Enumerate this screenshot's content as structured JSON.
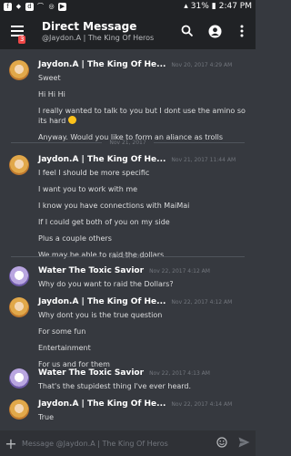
{
  "status_bar": {
    "left_icons": [
      "facebook-icon",
      "snapchat-icon",
      "discord-icon",
      "wifi-icon",
      "instagram-icon",
      "youtube-icon"
    ],
    "battery": "31%",
    "time": "2:47 PM"
  },
  "header": {
    "title": "Direct Message",
    "subtitle": "@Jaydon.A | The King Of Heros",
    "badge": "3"
  },
  "dividers": [
    "Nov 21, 2017",
    "Nov 22, 2017"
  ],
  "messages": [
    {
      "author": "Jaydon.A | The King Of He...",
      "time": "Nov 20, 2017 4:29 AM",
      "lines": [
        "Sweet",
        "Hi Hi Hi",
        "I really wanted to talk to you but I dont use the amino so its hard",
        "Anyway. Would you like to form an aliance as trolls"
      ]
    },
    {
      "author": "Jaydon.A | The King Of He...",
      "time": "Nov 21, 2017 11:44 AM",
      "lines": [
        "I feel I should be more specific",
        "I want you to work with me",
        "I know you have connections with MaiMai",
        "If I could get both of you on my side",
        "Plus a couple others",
        "We may be able to raid the dollars"
      ]
    },
    {
      "author": "Water The Toxic Savior",
      "time": "Nov 22, 2017 4:12 AM",
      "lines": [
        "Why do you want to raid the Dollars?"
      ]
    },
    {
      "author": "Jaydon.A | The King Of He...",
      "time": "Nov 22, 2017 4:12 AM",
      "lines": [
        "Why dont you is the true question",
        "For some fun",
        "Entertainment",
        "For us and for them"
      ]
    },
    {
      "author": "Water The Toxic Savior",
      "time": "Nov 22, 2017 4:13 AM",
      "lines": [
        "That's the stupidest thing I've ever heard."
      ]
    },
    {
      "author": "Jaydon.A | The King Of He...",
      "time": "Nov 22, 2017 4:14 AM",
      "lines": [
        "True"
      ]
    }
  ],
  "composer": {
    "placeholder": "Message @Jaydon.A | The King Of Heros"
  },
  "colors": {
    "background": "#36393f",
    "header": "#202225",
    "badge": "#f04747"
  }
}
